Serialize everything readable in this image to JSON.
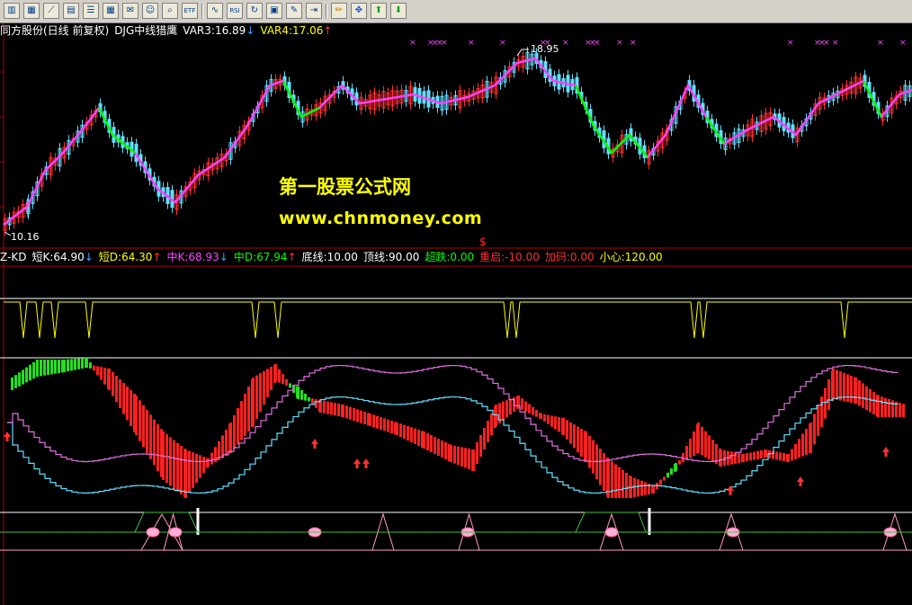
{
  "toolbar": {
    "buttons": [
      "candle-chart",
      "table",
      "line-chart",
      "grid",
      "report",
      "grid-alt",
      "mail",
      "people",
      "magnifier",
      "etf",
      "wave",
      "rsi",
      "refresh",
      "compare",
      "tools",
      "enter",
      "pen",
      "move",
      "up-arrow",
      "down-arrow"
    ],
    "labels": {
      "etf": "ETF",
      "rsi": "RSI"
    }
  },
  "main_chart": {
    "title_parts": [
      {
        "text": "同方股份(日线 前复权)",
        "color": "#ffffff"
      },
      {
        "text": "DJG中线猎鹰",
        "color": "#ffffff"
      },
      {
        "text": "VAR3:16.89",
        "color": "#ffffff"
      },
      {
        "text": "↓",
        "color": "#3fa0ff"
      },
      {
        "text": "VAR4:17.06",
        "color": "#ffff00"
      },
      {
        "text": "↑",
        "color": "#ff3030"
      }
    ],
    "high_label": "18.95",
    "low_label": "10.16",
    "dollar_mark": "$"
  },
  "indicator": {
    "title_parts": [
      {
        "text": "Z-KD",
        "color": "#ffffff"
      },
      {
        "text": "短K:64.90",
        "color": "#ffffff"
      },
      {
        "text": "↓",
        "color": "#3fa0ff"
      },
      {
        "text": "短D:64.30",
        "color": "#ffff00"
      },
      {
        "text": "↑",
        "color": "#ff3030"
      },
      {
        "text": "中K:68.93",
        "color": "#ff40ff"
      },
      {
        "text": "↓",
        "color": "#3fa0ff"
      },
      {
        "text": "中D:67.94",
        "color": "#00ff00"
      },
      {
        "text": "↑",
        "color": "#ff3030"
      },
      {
        "text": "底线:10.00",
        "color": "#ffffff"
      },
      {
        "text": "顶线:90.00",
        "color": "#ffffff"
      },
      {
        "text": "超跌:0.00",
        "color": "#00ff00"
      },
      {
        "text": "重启:-10.00",
        "color": "#ff3030"
      },
      {
        "text": "加码:0.00",
        "color": "#ff3030"
      },
      {
        "text": "小心:120.00",
        "color": "#ffff00"
      }
    ]
  },
  "watermark": {
    "line1": "第一股票公式网",
    "line2": "www.chnmoney.com"
  },
  "colors": {
    "up": "#ff3030",
    "down": "#00ff00",
    "cyan": "#60e0ff",
    "magenta": "#ff40ff",
    "yellow": "#ffff00",
    "pink": "#ff9fc0",
    "grid": "#b00000"
  }
}
